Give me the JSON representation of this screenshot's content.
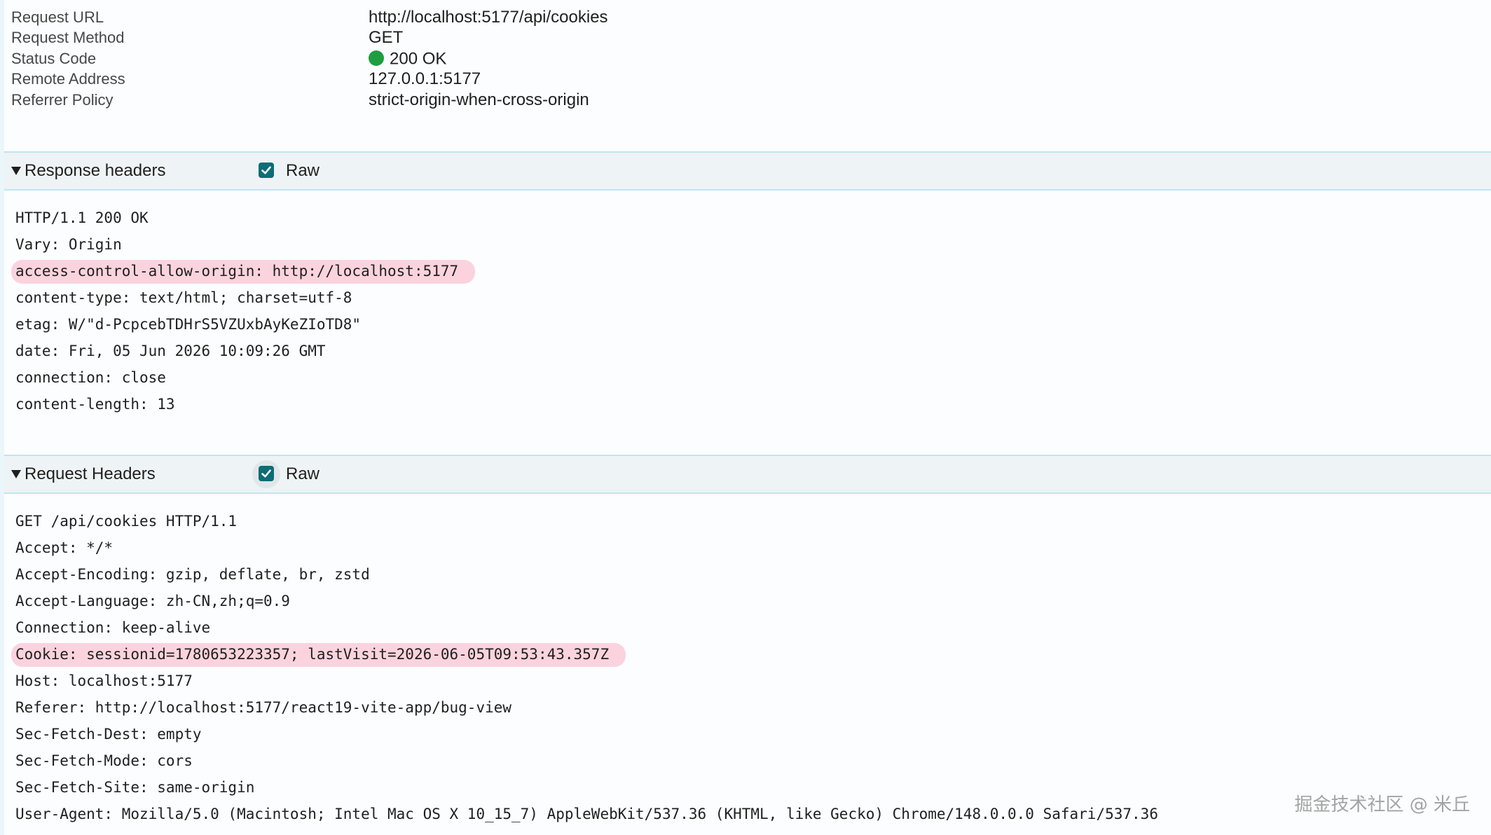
{
  "general": [
    {
      "key": "Request URL",
      "value": "http://localhost:5177/api/cookies"
    },
    {
      "key": "Request Method",
      "value": "GET"
    },
    {
      "key": "Status Code",
      "value": "200 OK",
      "status_color": "#1e9e3e"
    },
    {
      "key": "Remote Address",
      "value": "127.0.0.1:5177"
    },
    {
      "key": "Referrer Policy",
      "value": "strict-origin-when-cross-origin"
    }
  ],
  "response_headers": {
    "title": "Response headers",
    "raw_label": "Raw",
    "raw_checked": true,
    "lines": [
      "HTTP/1.1 200 OK",
      "Vary: Origin",
      "access-control-allow-origin: http://localhost:5177",
      "content-type: text/html; charset=utf-8",
      "etag: W/\"d-PcpcebTDHrS5VZUxbAyKeZIoTD8\"",
      "date: Fri, 05 Jun 2026 10:09:26 GMT",
      "connection: close",
      "content-length: 13"
    ],
    "highlighted_line_index": 2
  },
  "request_headers": {
    "title": "Request Headers",
    "raw_label": "Raw",
    "raw_checked": true,
    "lines": [
      "GET /api/cookies HTTP/1.1",
      "Accept: */*",
      "Accept-Encoding: gzip, deflate, br, zstd",
      "Accept-Language: zh-CN,zh;q=0.9",
      "Connection: keep-alive",
      "Cookie: sessionid=1780653223357; lastVisit=2026-06-05T09:53:43.357Z",
      "Host: localhost:5177",
      "Referer: http://localhost:5177/react19-vite-app/bug-view",
      "Sec-Fetch-Dest: empty",
      "Sec-Fetch-Mode: cors",
      "Sec-Fetch-Site: same-origin",
      "User-Agent: Mozilla/5.0 (Macintosh; Intel Mac OS X 10_15_7) AppleWebKit/537.36 (KHTML, like Gecko) Chrome/148.0.0.0 Safari/537.36"
    ],
    "highlighted_line_index": 5
  },
  "watermark": "掘金技术社区 @ 米丘",
  "colors": {
    "accent_checkbox": "#0a6d77",
    "highlight": "#fbd3de",
    "section_border": "#bfe5ef",
    "section_bg": "#eef3f5"
  }
}
